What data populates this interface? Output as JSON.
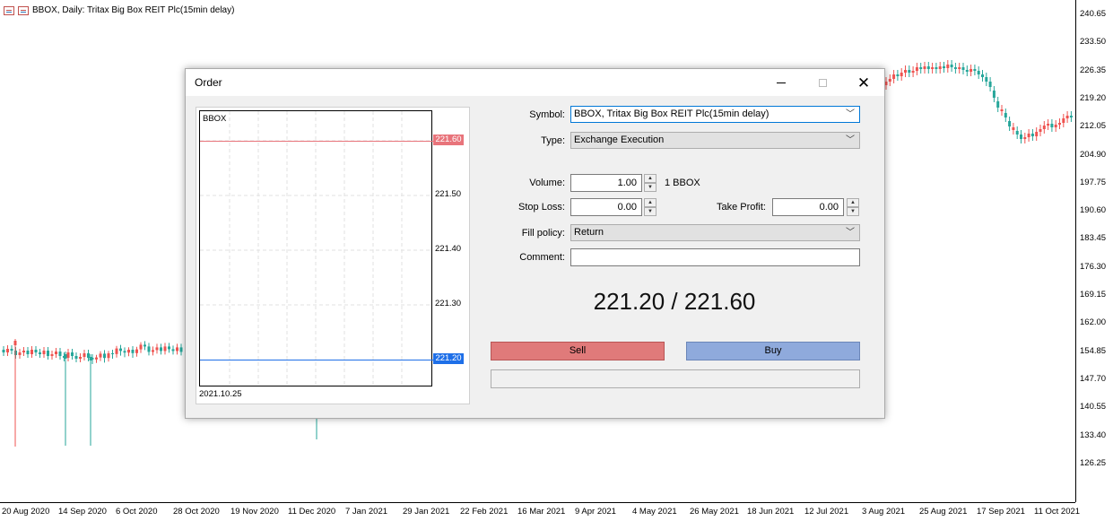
{
  "chart": {
    "title": "BBOX, Daily:  Tritax Big Box REIT Plc(15min delay)",
    "price_labels": [
      "240.65",
      "233.50",
      "226.35",
      "219.20",
      "212.05",
      "204.90",
      "197.75",
      "190.60",
      "183.45",
      "176.30",
      "169.15",
      "162.00",
      "154.85",
      "147.70",
      "140.55",
      "133.40",
      "126.25"
    ],
    "time_labels": [
      "20 Aug 2020",
      "14 Sep 2020",
      "6 Oct 2020",
      "28 Oct 2020",
      "19 Nov 2020",
      "11 Dec 2020",
      "7 Jan 2021",
      "29 Jan 2021",
      "22 Feb 2021",
      "16 Mar 2021",
      "9 Apr 2021",
      "4 May 2021",
      "26 May 2021",
      "18 Jun 2021",
      "12 Jul 2021",
      "3 Aug 2021",
      "25 Aug 2021",
      "17 Sep 2021",
      "11 Oct 2021"
    ],
    "colors": {
      "bull": "#26a69a",
      "bear": "#ef5350"
    }
  },
  "dialog": {
    "title": "Order",
    "mini_chart": {
      "symbol": "BBOX",
      "date": "2021.10.25",
      "levels": [
        "221.50",
        "221.40",
        "221.30"
      ],
      "ask": "221.60",
      "bid": "221.20"
    },
    "labels": {
      "symbol": "Symbol:",
      "type": "Type:",
      "volume": "Volume:",
      "stop_loss": "Stop Loss:",
      "take_profit": "Take Profit:",
      "fill_policy": "Fill policy:",
      "comment": "Comment:"
    },
    "values": {
      "symbol": "BBOX, Tritax Big Box REIT Plc(15min delay)",
      "type": "Exchange Execution",
      "volume": "1.00",
      "volume_unit": "1 BBOX",
      "stop_loss": "0.00",
      "take_profit": "0.00",
      "fill_policy": "Return",
      "comment": ""
    },
    "price_display": "221.20 / 221.60",
    "sell_label": "Sell",
    "buy_label": "Buy"
  }
}
